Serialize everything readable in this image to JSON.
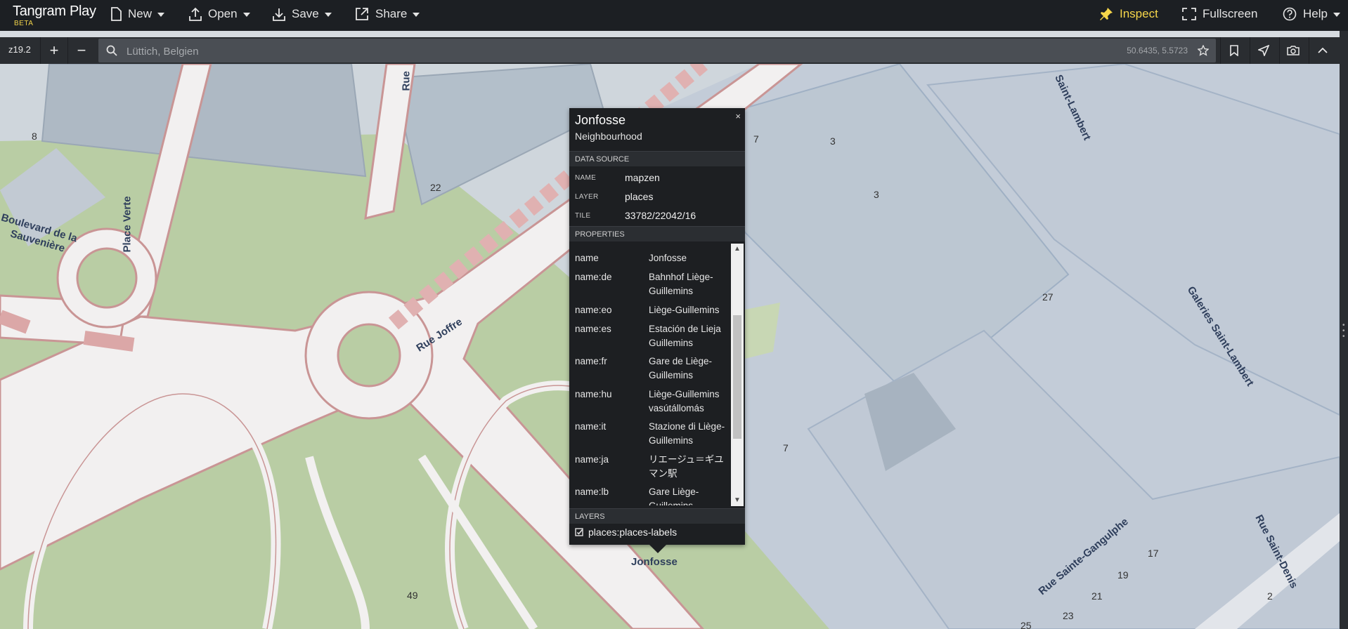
{
  "app": {
    "title": "Tangram Play",
    "badge": "BETA"
  },
  "menu": {
    "new": "New",
    "open": "Open",
    "save": "Save",
    "share": "Share",
    "inspect": "Inspect",
    "fullscreen": "Fullscreen",
    "help": "Help"
  },
  "toolbar": {
    "zoom": "z19.2",
    "zoom_in": "+",
    "zoom_out": "−",
    "search_placeholder": "Lüttich, Belgien",
    "coordinates": "50.6435, 5.5723"
  },
  "map": {
    "road_labels": [
      "Rue Joffre",
      "Boulevard de la",
      "Sauvenière",
      "Place Verte",
      "Rue",
      "Saint-Lambert",
      "Galeries Saint-Lambert",
      "Rue Sainte-Gangulphe",
      "Rue Saint-Denis"
    ],
    "place_label": "Jonfosse",
    "house_numbers": [
      "8",
      "22",
      "7",
      "3",
      "3",
      "27",
      "7",
      "49",
      "17",
      "19",
      "21",
      "2",
      "23",
      "25"
    ]
  },
  "popup": {
    "close": "×",
    "title": "Jonfosse",
    "subtitle": "Neighbourhood",
    "data_source_header": "DATA SOURCE",
    "source": [
      {
        "key": "NAME",
        "value": "mapzen"
      },
      {
        "key": "LAYER",
        "value": "places"
      },
      {
        "key": "TILE",
        "value": "33782/22042/16"
      }
    ],
    "properties_header": "PROPERTIES",
    "properties": [
      {
        "key": "name",
        "value": "Jonfosse"
      },
      {
        "key": "name:de",
        "value": "Bahnhof Liège-Guillemins"
      },
      {
        "key": "name:eo",
        "value": "Liège-Guillemins"
      },
      {
        "key": "name:es",
        "value": "Estación de Lieja Guillemins"
      },
      {
        "key": "name:fr",
        "value": "Gare de Liège-Guillemins"
      },
      {
        "key": "name:hu",
        "value": "Liège-Guillemins vasútállomás"
      },
      {
        "key": "name:it",
        "value": "Stazione di Liège-Guillemins"
      },
      {
        "key": "name:ja",
        "value": "リエージュ＝ギユマン駅"
      },
      {
        "key": "name:lb",
        "value": "Gare Liège-Guillemins"
      }
    ],
    "layers_header": "LAYERS",
    "layer": "places:places-labels"
  }
}
